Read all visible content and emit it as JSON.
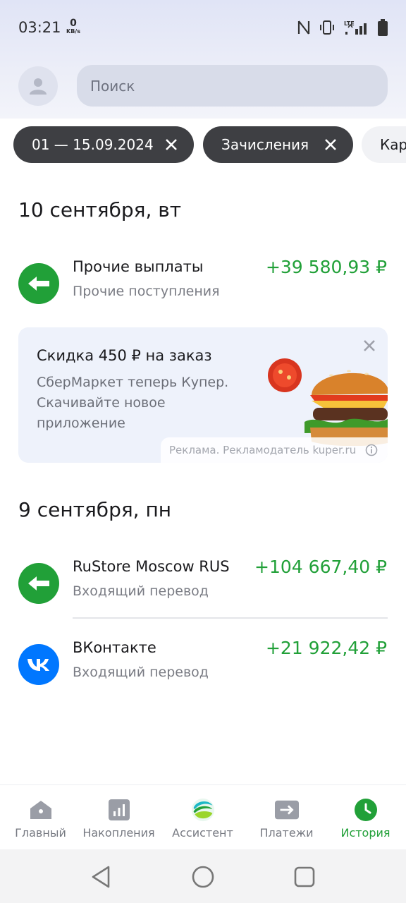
{
  "status_bar": {
    "time": "03:21",
    "net_speed_value": "0",
    "net_speed_unit": "KB/s",
    "network_type": "LTE"
  },
  "header": {
    "search_placeholder": "Поиск"
  },
  "filters": [
    {
      "label": "01 — 15.09.2024"
    },
    {
      "label": "Зачисления"
    },
    {
      "label": "Кар"
    }
  ],
  "groups": [
    {
      "date": "10 сентября, вт",
      "operations": [
        {
          "title": "Прочие выплаты",
          "subtitle": "Прочие поступления",
          "amount": "+39 580,93 ₽",
          "icon": "arrow-left-icon"
        }
      ]
    },
    {
      "date": "9 сентября, пн",
      "operations": [
        {
          "title": "RuStore Moscow RUS",
          "subtitle": "Входящий перевод",
          "amount": "+104 667,40 ₽",
          "icon": "arrow-left-icon"
        },
        {
          "title": "ВКонтакте",
          "subtitle": "Входящий перевод",
          "amount": "+21 922,42 ₽",
          "icon": "vk-icon"
        }
      ]
    }
  ],
  "ad": {
    "title": "Скидка 450 ₽ на заказ",
    "text": "СберМаркет теперь Купер. Скачивайте новое приложение",
    "footer": "Реклама. Рекламодатель kuper.ru"
  },
  "bottom_nav": [
    {
      "label": "Главный",
      "icon": "home-icon"
    },
    {
      "label": "Накопления",
      "icon": "chart-icon"
    },
    {
      "label": "Ассистент",
      "icon": "sber-assistant-icon"
    },
    {
      "label": "Платежи",
      "icon": "transfer-icon"
    },
    {
      "label": "История",
      "icon": "history-icon",
      "active": true
    }
  ],
  "colors": {
    "accent": "#21a038",
    "vk": "#0077ff",
    "chip_dark": "#3e3f43"
  }
}
